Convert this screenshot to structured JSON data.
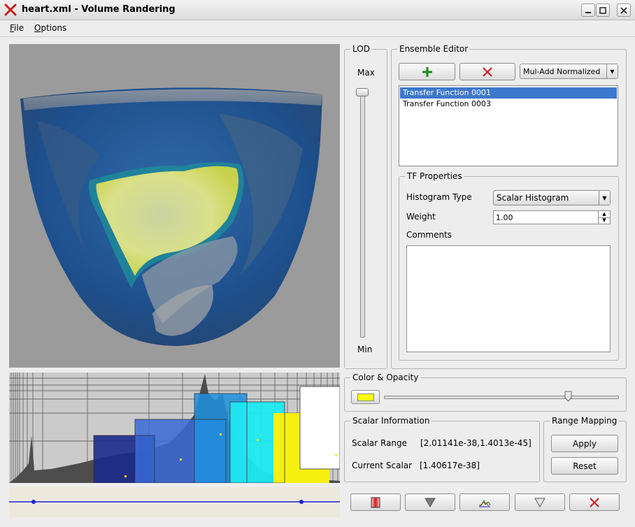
{
  "window": {
    "title": "heart.xml - Volume Randering",
    "controls": [
      "minimize",
      "maximize",
      "close"
    ]
  },
  "menu": {
    "file": {
      "access_key": "F",
      "rest": "ile"
    },
    "options": {
      "access_key": "O",
      "rest": "ptions"
    }
  },
  "lod": {
    "title": "LOD",
    "max_label": "Max",
    "min_label": "Min",
    "level": 1.0
  },
  "ensemble_editor": {
    "title": "Ensemble Editor",
    "add_icon": "plus-icon",
    "remove_icon": "x-icon",
    "mode_selected": "Mul-Add Normalized",
    "transfer_functions": [
      {
        "label": "Transfer Function 0001",
        "selected": true
      },
      {
        "label": "Transfer Function 0003",
        "selected": false
      }
    ]
  },
  "tf_properties": {
    "title": "TF Properties",
    "histogram_type_label": "Histogram Type",
    "histogram_type_value": "Scalar Histogram",
    "weight_label": "Weight",
    "weight_value": "1.00",
    "comments_label": "Comments",
    "comments_value": ""
  },
  "color_opacity": {
    "title": "Color & Opacity",
    "swatch_color": "#ffff00",
    "opacity_level": 0.79
  },
  "scalar_info": {
    "title": "Scalar Information",
    "range_label": "Scalar Range",
    "range_value": "[2.01141e-38,1.4013e-45]",
    "current_label": "Current Scalar",
    "current_value": "[1.40617e-38]"
  },
  "range_mapping": {
    "title": "Range Mapping",
    "apply_label": "Apply",
    "reset_label": "Reset"
  },
  "toolbar": {
    "icons": [
      "color-swatch-icon",
      "triangle-down-icon",
      "curve-icon",
      "triangle-down-outline-icon",
      "x-icon"
    ]
  },
  "colors": {
    "selection": "#3c78cc",
    "accent_green": "#1a8c1a",
    "accent_red": "#cc1a1a",
    "curve_blue": "#1f1fd6"
  }
}
